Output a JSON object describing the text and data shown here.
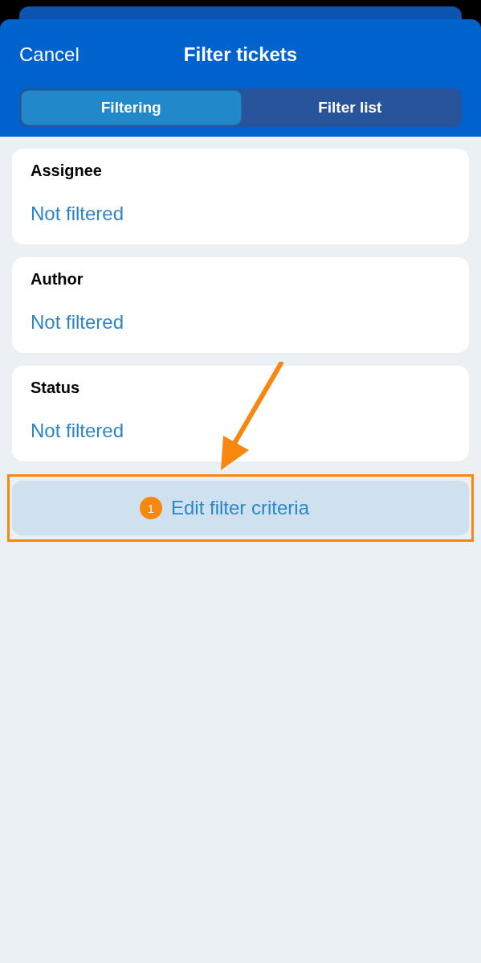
{
  "header": {
    "cancel": "Cancel",
    "title": "Filter tickets"
  },
  "segments": [
    {
      "label": "Filtering",
      "selected": true
    },
    {
      "label": "Filter list",
      "selected": false
    }
  ],
  "filters": [
    {
      "label": "Assignee",
      "value": "Not filtered"
    },
    {
      "label": "Author",
      "value": "Not filtered"
    },
    {
      "label": "Status",
      "value": "Not filtered"
    }
  ],
  "action_button": {
    "label": "Edit filter criteria",
    "step": "1"
  }
}
